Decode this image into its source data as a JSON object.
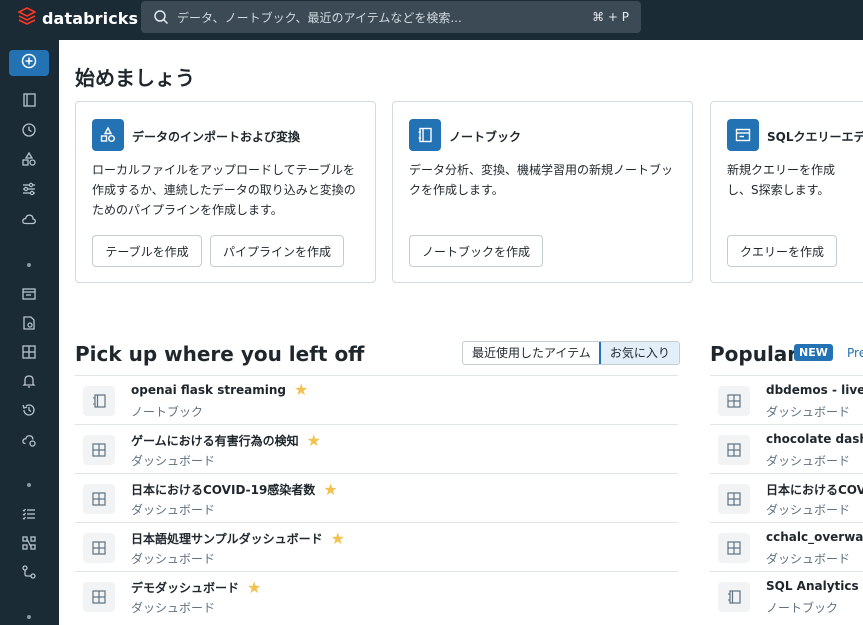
{
  "header": {
    "brand": "databricks",
    "search_placeholder": "データ、ノートブック、最近のアイテムなどを検索...",
    "search_shortcut": "⌘ + P"
  },
  "colors": {
    "topbar": "#1b2b36",
    "accent": "#2272b4",
    "star": "#f2c14e"
  },
  "sidebar": {
    "icons": [
      "plus-circle-icon",
      "workspace-icon",
      "clock-icon",
      "catalog-icon",
      "workflows-icon",
      "cloud-icon",
      "sql-editor-icon",
      "queries-icon",
      "dashboards-icon",
      "alerts-icon",
      "query-history-icon",
      "warehouse-icon",
      "experiments-icon",
      "features-icon",
      "models-icon"
    ]
  },
  "get_started": {
    "title": "始めましょう",
    "cards": [
      {
        "title": "データのインポートおよび変換",
        "desc": "ローカルファイルをアップロードしてテーブルを作成するか、連続したデータの取り込みと変換のためのパイプラインを作成します。",
        "buttons": [
          "テーブルを作成",
          "パイプラインを作成"
        ]
      },
      {
        "title": "ノートブック",
        "desc": "データ分析、変換、機械学習用の新規ノートブックを作成します。",
        "buttons": [
          "ノートブックを作成"
        ]
      },
      {
        "title": "SQLクエリーエデ",
        "desc": "新規クエリーを作成し、S探索します。",
        "buttons": [
          "クエリーを作成"
        ]
      }
    ]
  },
  "recent": {
    "title": "Pick up where you left off",
    "toggle": [
      "最近使用したアイテム",
      "お気に入り"
    ],
    "items": [
      {
        "name": "openai flask streaming",
        "type": "ノートブック",
        "icon": "notebook-icon"
      },
      {
        "name": "ゲームにおける有害行為の検知",
        "type": "ダッシュボード",
        "icon": "dashboard-icon"
      },
      {
        "name": "日本におけるCOVID-19感染者数",
        "type": "ダッシュボード",
        "icon": "dashboard-icon"
      },
      {
        "name": "日本語処理サンプルダッシュボード",
        "type": "ダッシュボード",
        "icon": "dashboard-icon"
      },
      {
        "name": "デモダッシュボード",
        "type": "ダッシュボード",
        "icon": "dashboard-icon"
      }
    ]
  },
  "popular": {
    "title": "Popular",
    "badge": "NEW",
    "link": "Pre",
    "items": [
      {
        "name": "dbdemos - live_",
        "type": "ダッシュボード",
        "icon": "dashboard-icon"
      },
      {
        "name": "chocolate dashl",
        "type": "ダッシュボード",
        "icon": "dashboard-icon"
      },
      {
        "name": "日本におけるCOV",
        "type": "ダッシュボード",
        "icon": "dashboard-icon"
      },
      {
        "name": "cchalc_overwat",
        "type": "ダッシュボード",
        "icon": "dashboard-icon"
      },
      {
        "name": "SQL Analytics",
        "type": "ノートブック",
        "icon": "notebook-icon"
      }
    ]
  }
}
